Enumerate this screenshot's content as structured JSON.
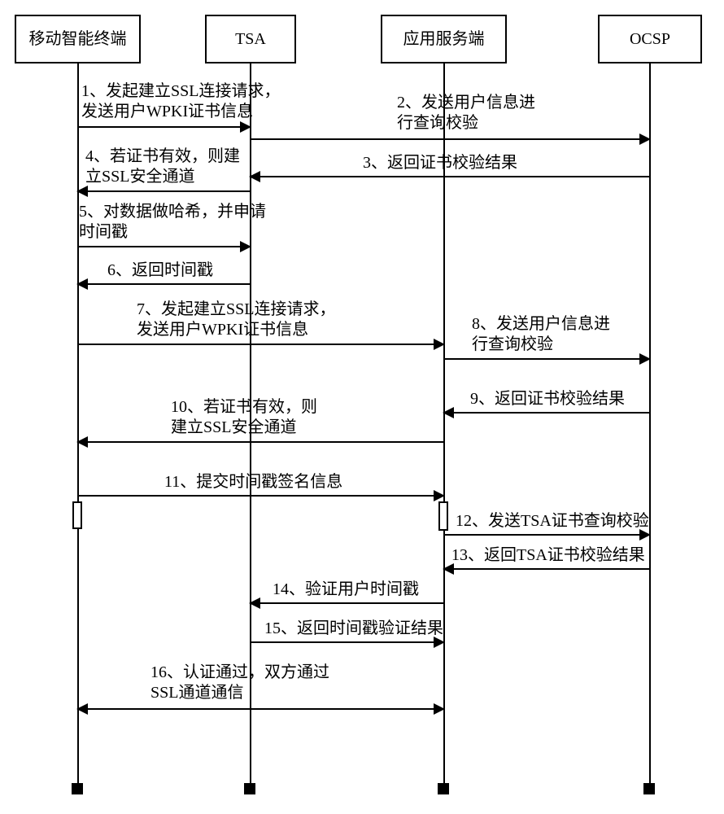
{
  "participants": {
    "terminal": "移动智能终端",
    "tsa": "TSA",
    "server": "应用服务端",
    "ocsp": "OCSP"
  },
  "messages": {
    "m1": "1、发起建立SSL连接请求，\n发送用户WPKI证书信息",
    "m2": "2、发送用户信息进\n行查询校验",
    "m3": "3、返回证书校验结果",
    "m4": "4、若证书有效，则建\n立SSL安全通道",
    "m5": "5、对数据做哈希，并申请\n时间戳",
    "m6": "6、返回时间戳",
    "m7": "7、发起建立SSL连接请求，\n发送用户WPKI证书信息",
    "m8": "8、发送用户信息进\n行查询校验",
    "m9": "9、返回证书校验结果",
    "m10": "10、若证书有效，则\n建立SSL安全通道",
    "m11": "11、提交时间戳签名信息",
    "m12": "12、发送TSA证书查询校验",
    "m13": "13、返回TSA证书校验结果",
    "m14": "14、验证用户时间戳",
    "m15": "15、返回时间戳验证结果",
    "m16": "16、认证通过，双方通过\nSSL通道通信"
  }
}
